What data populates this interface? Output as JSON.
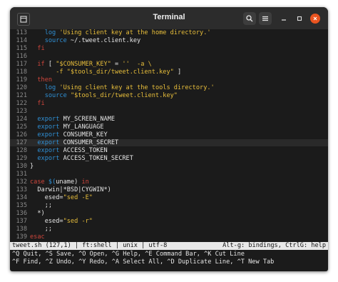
{
  "window": {
    "title": "Terminal"
  },
  "icons": {
    "new_tab": "new-tab-icon",
    "search": "search-icon",
    "menu": "hamburger-menu-icon",
    "minimize": "minimize-icon",
    "maximize": "maximize-icon",
    "close": "close-icon"
  },
  "colors": {
    "keyword": "#d0463c",
    "string": "#e9bf3b",
    "builtin": "#2f8fd4",
    "close_button": "#e95420"
  },
  "editor": {
    "current_line": "127",
    "lines": [
      {
        "n": "113",
        "code": "    log 'Using client key at the home directory.'"
      },
      {
        "n": "114",
        "code": "    source ~/.tweet.client.key"
      },
      {
        "n": "115",
        "code": "  fi"
      },
      {
        "n": "116",
        "code": ""
      },
      {
        "n": "117",
        "code": "  if [ \"$CONSUMER_KEY\" = ''  -a \\"
      },
      {
        "n": "118",
        "code": "       -f \"$tools_dir/tweet.client.key\" ]"
      },
      {
        "n": "119",
        "code": "  then"
      },
      {
        "n": "120",
        "code": "    log 'Using client key at the tools directory.'"
      },
      {
        "n": "121",
        "code": "    source \"$tools_dir/tweet.client.key\""
      },
      {
        "n": "122",
        "code": "  fi"
      },
      {
        "n": "123",
        "code": ""
      },
      {
        "n": "124",
        "code": "  export MY_SCREEN_NAME"
      },
      {
        "n": "125",
        "code": "  export MY_LANGUAGE"
      },
      {
        "n": "126",
        "code": "  export CONSUMER_KEY"
      },
      {
        "n": "127",
        "code": "  export CONSUMER_SECRET"
      },
      {
        "n": "128",
        "code": "  export ACCESS_TOKEN"
      },
      {
        "n": "129",
        "code": "  export ACCESS_TOKEN_SECRET"
      },
      {
        "n": "130",
        "code": "}"
      },
      {
        "n": "131",
        "code": ""
      },
      {
        "n": "132",
        "code": "case $(uname) in"
      },
      {
        "n": "133",
        "code": "  Darwin|*BSD|CYGWIN*)"
      },
      {
        "n": "134",
        "code": "    esed=\"sed -E\""
      },
      {
        "n": "135",
        "code": "    ;;"
      },
      {
        "n": "136",
        "code": "  *)"
      },
      {
        "n": "137",
        "code": "    esed=\"sed -r\""
      },
      {
        "n": "138",
        "code": "    ;;"
      },
      {
        "n": "139",
        "code": "esac"
      }
    ]
  },
  "status": {
    "left": "tweet.sh (127,1) | ft:shell | unix | utf-8",
    "right": "Alt-g: bindings, CtrlG: help"
  },
  "help": [
    "^Q Quit, ^S Save, ^O Open, ^G Help, ^E Command Bar, ^K Cut Line",
    "^F Find, ^Z Undo, ^Y Redo, ^A Select All, ^D Duplicate Line, ^T New Tab"
  ]
}
